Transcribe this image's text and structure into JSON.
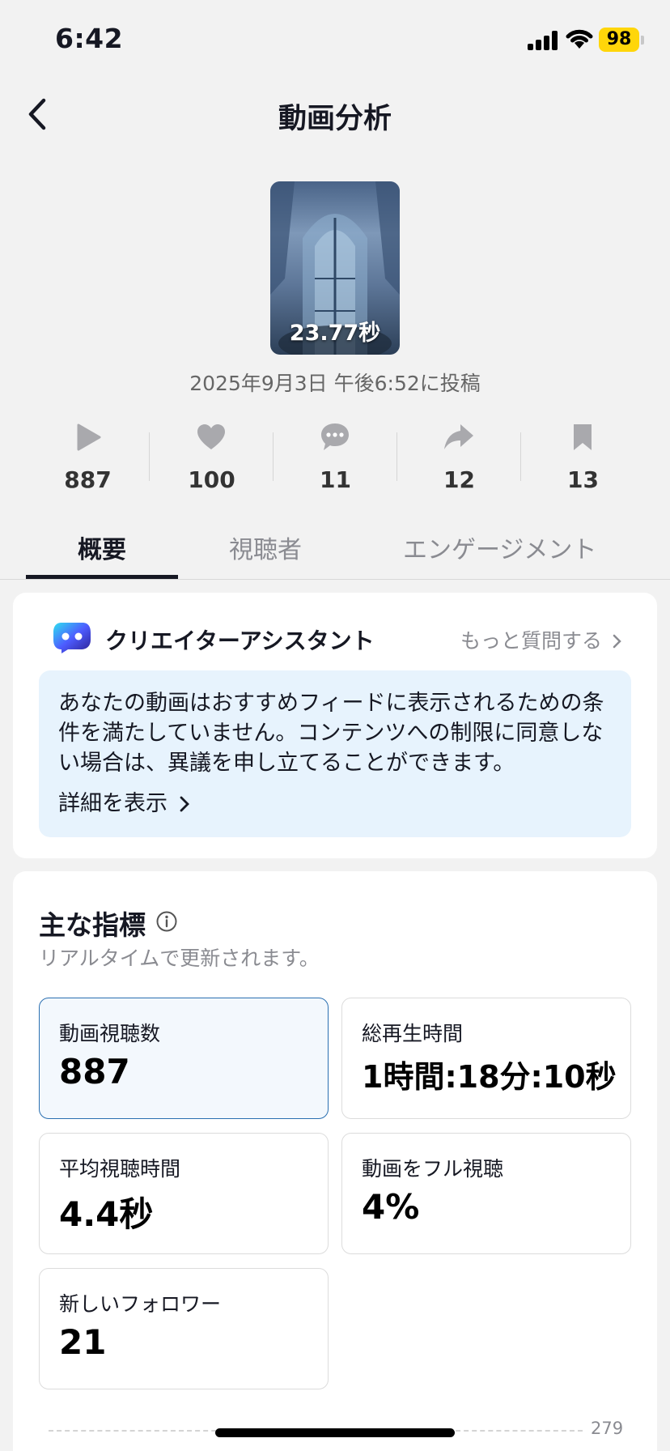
{
  "status_bar": {
    "time": "6:42",
    "battery": "98"
  },
  "nav": {
    "title": "動画分析"
  },
  "video": {
    "duration": "23.77秒",
    "posted": "2025年9月3日 午後6:52に投稿"
  },
  "stats": [
    {
      "icon": "play-icon",
      "value": "887"
    },
    {
      "icon": "heart-icon",
      "value": "100"
    },
    {
      "icon": "comment-icon",
      "value": "11"
    },
    {
      "icon": "share-icon",
      "value": "12"
    },
    {
      "icon": "bookmark-icon",
      "value": "13"
    }
  ],
  "tabs": [
    {
      "label": "概要",
      "active": true
    },
    {
      "label": "視聴者",
      "active": false
    },
    {
      "label": "エンゲージメント",
      "active": false
    }
  ],
  "assistant": {
    "title": "クリエイターアシスタント",
    "ask_more": "もっと質問する",
    "notice": "あなたの動画はおすすめフィードに表示されるための条件を満たしていません。コンテンツへの制限に同意しない場合は、異議を申し立てることができます。",
    "details_link": "詳細を表示"
  },
  "metrics": {
    "title": "主な指標",
    "subtitle": "リアルタイムで更新されます。",
    "items": [
      {
        "label": "動画視聴数",
        "value": "887",
        "selected": true
      },
      {
        "label": "総再生時間",
        "value": "1時間:18分:10秒",
        "selected": false
      },
      {
        "label": "平均視聴時間",
        "value": "4.4秒",
        "selected": false
      },
      {
        "label": "動画をフル視聴",
        "value": "4%",
        "selected": false
      },
      {
        "label": "新しいフォロワー",
        "value": "21",
        "selected": false
      }
    ],
    "chart_tick": "279"
  },
  "colors": {
    "accent": "#2a6fb1",
    "notice_bg": "#e7f3fd",
    "battery": "#ffd60a"
  }
}
